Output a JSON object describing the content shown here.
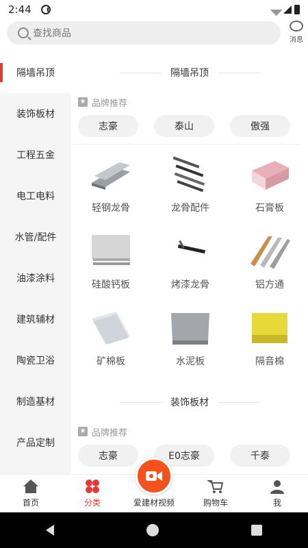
{
  "status": {
    "time": "2:44"
  },
  "search": {
    "placeholder": "查找商品"
  },
  "message": {
    "label": "消息"
  },
  "sidebar": {
    "items": [
      {
        "label": "隔墙吊顶",
        "active": true
      },
      {
        "label": "装饰板材"
      },
      {
        "label": "工程五金"
      },
      {
        "label": "电工电料"
      },
      {
        "label": "水管/配件"
      },
      {
        "label": "油漆涂料"
      },
      {
        "label": "建筑辅材"
      },
      {
        "label": "陶瓷卫浴"
      },
      {
        "label": "制造基材"
      },
      {
        "label": "产品定制"
      }
    ]
  },
  "sections": [
    {
      "title": "隔墙吊顶",
      "brand_header": "品牌推荐",
      "brands": [
        "志豪",
        "泰山",
        "傲强"
      ],
      "products": [
        "轻钢龙骨",
        "龙骨配件",
        "石膏板",
        "硅酸钙板",
        "烤漆龙骨",
        "铝方通",
        "矿棉板",
        "水泥板",
        "隔音棉"
      ]
    },
    {
      "title": "装饰板材",
      "brand_header": "品牌推荐",
      "brands": [
        "志豪",
        "E0志豪",
        "千泰"
      ]
    }
  ],
  "tabs": [
    {
      "label": "首页",
      "icon": "home-icon"
    },
    {
      "label": "分类",
      "icon": "category-icon",
      "active": true
    },
    {
      "label": "爱建材视频",
      "icon": "video-icon"
    },
    {
      "label": "购物车",
      "icon": "cart-icon"
    },
    {
      "label": "我",
      "icon": "user-icon"
    }
  ],
  "colors": {
    "accent": "#e53935",
    "video_button": "#f4511e"
  }
}
